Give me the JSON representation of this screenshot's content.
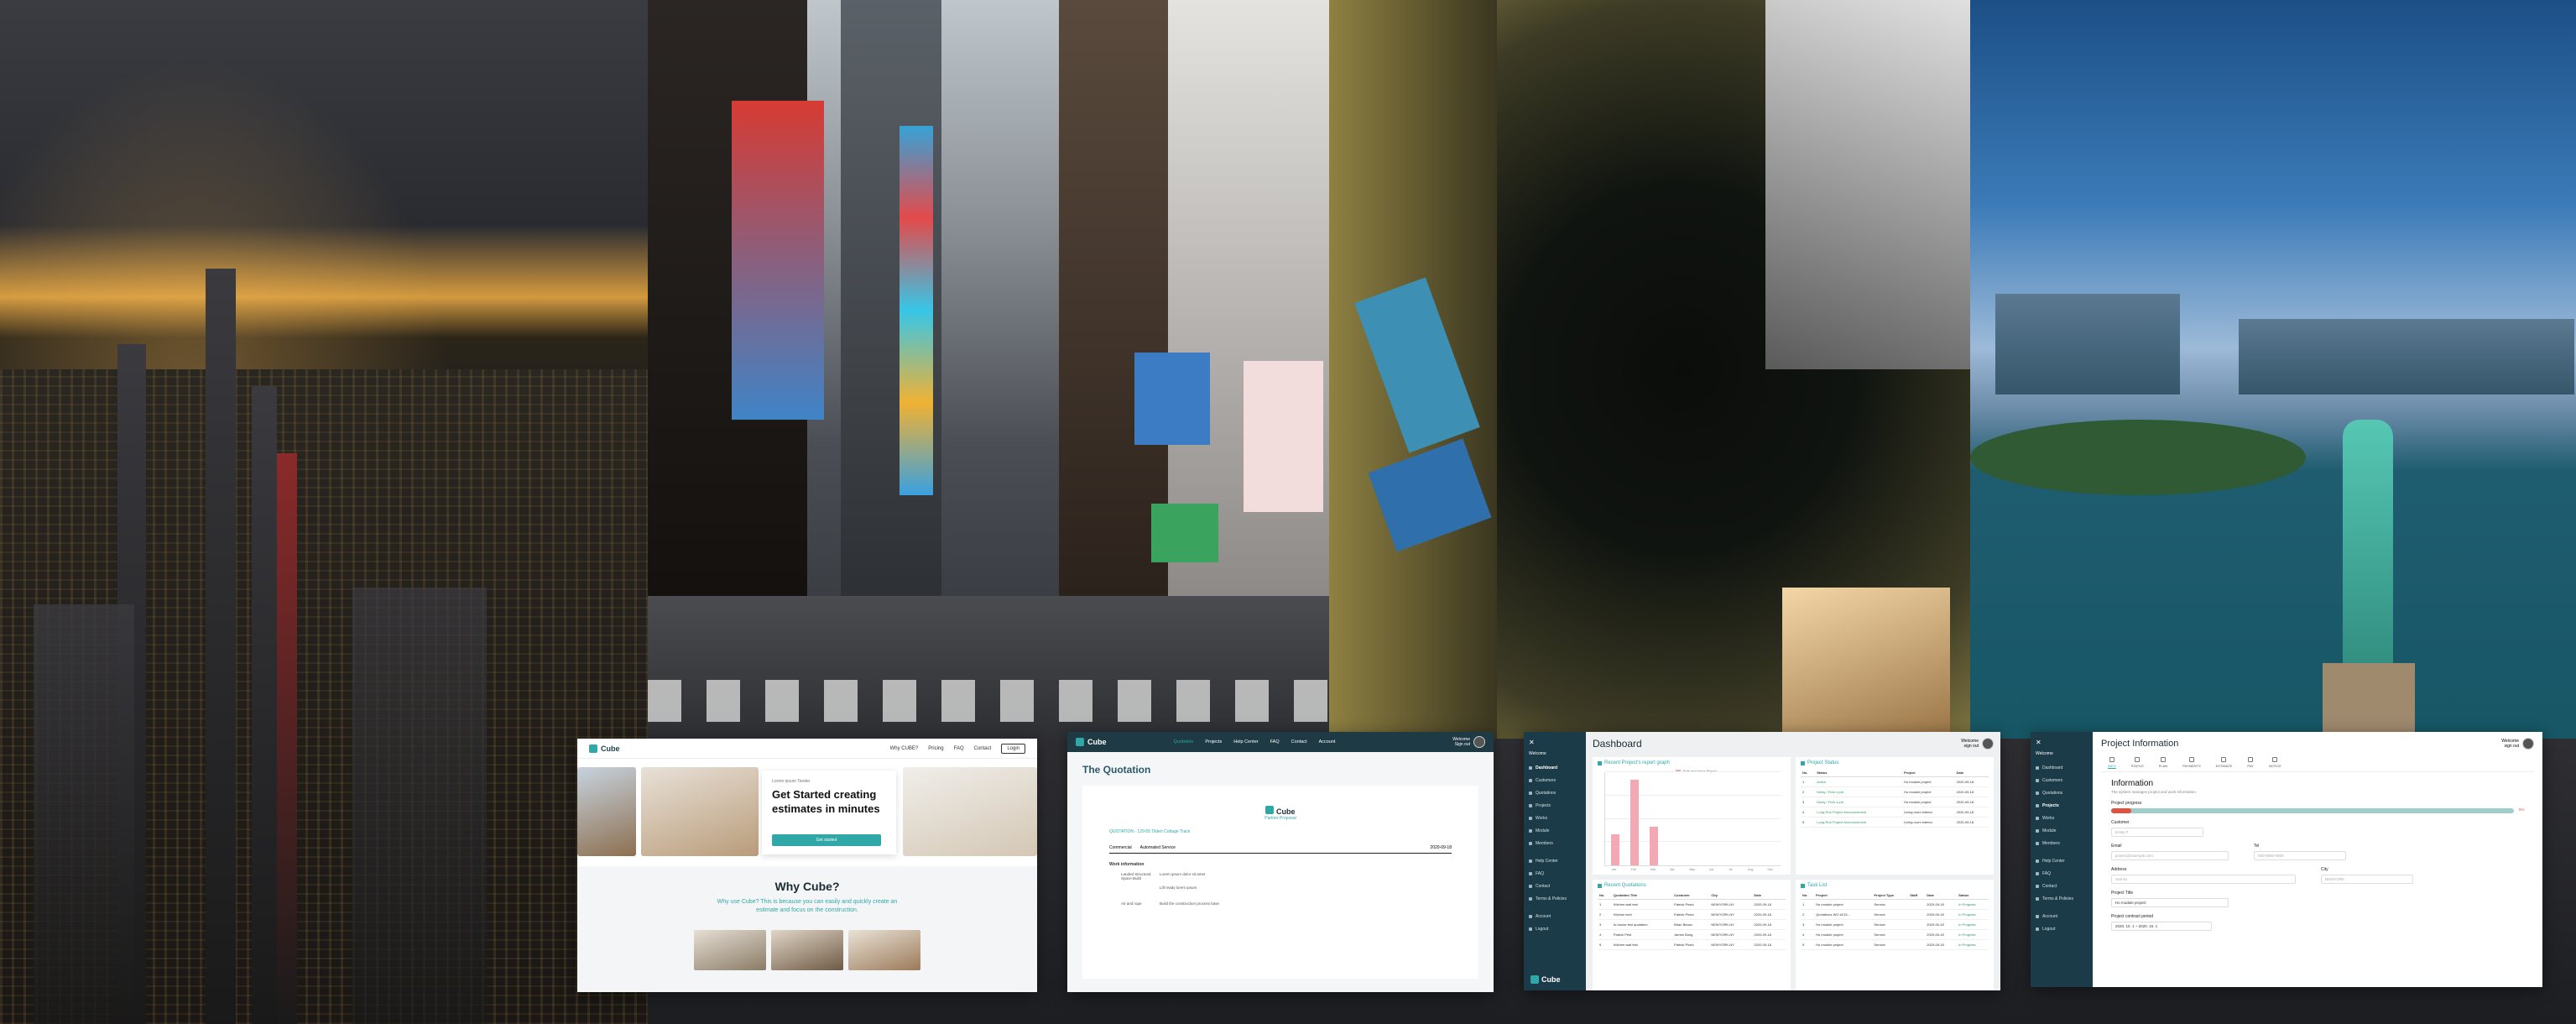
{
  "landing": {
    "brand": "Cube",
    "nav_links": [
      "Why CUBE?",
      "Pricing",
      "FAQ",
      "Contact"
    ],
    "login": "Login",
    "hero_small": "Lorem ipsum Tender",
    "hero_title": "Get Started creating estimates in minutes",
    "hero_button": "Get started",
    "why_title": "Why Cube?",
    "why_text": "Why use Cube? This is because you can easily and quickly create an estimate and focus on the construction."
  },
  "quotation": {
    "brand": "Cube",
    "menu": [
      "Quotation",
      "Projects",
      "Help Center",
      "FAQ",
      "Contact",
      "Account"
    ],
    "user_name": "Welcome",
    "user_sub": "Sign out",
    "title": "The Quotation",
    "doc_brand": "Cube",
    "doc_tag": "Partner Proposal",
    "quote_line": "QUOTATION - 129-55 Tilden Cottage Track",
    "row_a": "Commercial",
    "row_b": "Automated Service",
    "row_date": "2020-09-18",
    "section": "Work information",
    "kv1_k": "Landed Structural Space Build",
    "kv1_v": "Lorem ipsum dolor sit amet",
    "kv2_k": "",
    "kv2_v": "Lift ready lorem ipsum",
    "kv3_k": "Air and rope",
    "kv3_v": "Build the construction process base"
  },
  "sidebar": {
    "close": "✕",
    "welcome": "Welcome",
    "items": [
      "Dashboard",
      "Customers",
      "Quotations",
      "Projects",
      "Works",
      "Module",
      "Members"
    ],
    "items2": [
      "Help Center",
      "FAQ",
      "Contact",
      "Terms & Policies"
    ],
    "items3": [
      "Account",
      "Logout"
    ],
    "logo": "Cube"
  },
  "dashboard": {
    "title": "Dashboard",
    "user_name": "Welcome",
    "user_sub": "sign out",
    "card1": "Recent Project's report graph",
    "legend": "Rate and Issue Report",
    "card2": "Project Status",
    "card3": "Recent Quotations",
    "card4": "Task List",
    "status_headers": [
      "No.",
      "Status",
      "Project",
      "Date"
    ],
    "status_rows": [
      [
        "1",
        "Active",
        "Ho module project",
        "2020-09-18"
      ],
      [
        "2",
        "Delay / Fixin a job",
        "Ho module project",
        "2020-09-18"
      ],
      [
        "3",
        "Delay / Fixin a job",
        "Ho module project",
        "2020-09-18"
      ],
      [
        "4",
        "Long-Run Project Announcement",
        "Living room interior",
        "2020-09-18"
      ],
      [
        "5",
        "Long-Run Project Announcement",
        "Living room interior",
        "2020-09-18"
      ]
    ],
    "quote_headers": [
      "No.",
      "Quotation Title",
      "Customer",
      "City",
      "Date"
    ],
    "quote_rows": [
      [
        "1",
        "Kitchen wall test",
        "Patrick Pines",
        "NEWYORK-NY",
        "2020-09-18"
      ],
      [
        "2",
        "Kitchen tech",
        "Patrick Pines",
        "NEWYORK-NY",
        "2020-09-18"
      ],
      [
        "3",
        "In-house test quotation",
        "Brian Beaux",
        "NEWYORK-NY",
        "2020-09-18"
      ],
      [
        "4",
        "Patrick Pest",
        "James Bong",
        "NEWYORK-NY",
        "2020-09-18"
      ],
      [
        "5",
        "Kitchen wall test",
        "Patrick Pines",
        "NEWYORK-NY",
        "2020-09-18"
      ]
    ],
    "task_headers": [
      "No.",
      "Project",
      "Project Type",
      "Staff",
      "Date",
      "Status"
    ],
    "task_rows": [
      [
        "1",
        "Ho module project",
        "Service",
        "",
        "2020-09-18",
        "In Progress"
      ],
      [
        "2",
        "Quotations WO #213...",
        "Service",
        "",
        "2020-09-18",
        "In Progress"
      ],
      [
        "3",
        "Ho module project",
        "Service",
        "",
        "2020-09-18",
        "In Progress"
      ],
      [
        "4",
        "Ho module project",
        "Service",
        "",
        "2020-09-18",
        "In Progress"
      ],
      [
        "5",
        "Ho module project",
        "Service",
        "",
        "2020-09-18",
        "In Progress"
      ]
    ],
    "chart": {
      "months": [
        "Jan",
        "Feb",
        "Mar",
        "Apr",
        "May",
        "Jun",
        "Jul",
        "Aug",
        "Sep"
      ],
      "values": [
        4,
        11,
        5,
        0,
        0,
        0,
        0,
        0,
        0
      ],
      "ymax": 12
    }
  },
  "project": {
    "title": "Project Information",
    "user_name": "Welcome",
    "user_sub": "sign out",
    "tabs": [
      "INFO",
      "STATUS",
      "PLAN",
      "PAYMENTS",
      "ESTIMATE",
      "PAY",
      "NOTICE"
    ],
    "section": "Information",
    "section_sub": "The system manages project and work information.",
    "progress_label": "Project progress",
    "progress_value": 0.05,
    "progress_pct": "5%",
    "customer_label": "Customer",
    "customer_value": "Entity P",
    "email_label": "Email",
    "email_value": "project@example.com",
    "tel_label": "Tel",
    "tel_value": "000-0000-0000",
    "address_label": "Address",
    "address_value": "Sub-ku",
    "city_label": "City",
    "city_value": "NEWYORK",
    "project_title_label": "Project Title",
    "project_title_value": "Ho module project",
    "period_label": "Project contract period",
    "period_value": "2020. 10. 1  ~  2020. 10. 1"
  }
}
